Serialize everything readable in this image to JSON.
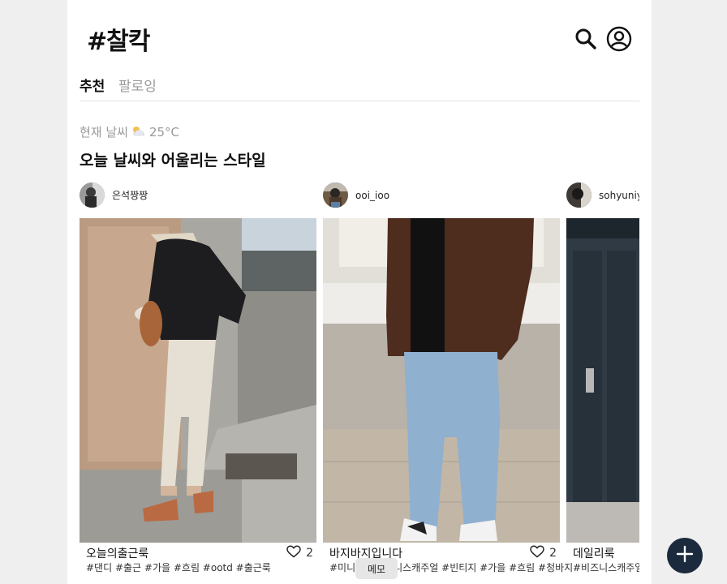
{
  "app": {
    "logo": "#찰칵"
  },
  "header": {
    "search_icon": "search-icon",
    "profile_icon": "user-circle-icon"
  },
  "tabs": [
    {
      "label": "추천",
      "active": true
    },
    {
      "label": "팔로잉",
      "active": false
    }
  ],
  "weather": {
    "label": "현재 날씨",
    "icon": "partly-cloudy-icon",
    "temperature": "25°C"
  },
  "section": {
    "title": "오늘 날씨와 어울리는 스타일"
  },
  "posts": [
    {
      "username": "은석짱짱",
      "caption": "오늘의출근룩",
      "likes": "2",
      "tags": "#댄디 #출근 #가을 #흐림 #ootd #출근룩"
    },
    {
      "username": "ooi_ioo",
      "caption": "바지바지입니다",
      "likes": "2",
      "tags": "#미니멀 #비즈니스캐주얼 #빈티지 #가을 #흐림 #청바지"
    },
    {
      "username": "sohyuniy",
      "caption": "데일리룩",
      "likes": "",
      "tags": "#비즈니스캐주얼"
    }
  ],
  "memo": {
    "label": "메모"
  },
  "fab": {
    "icon": "plus-icon"
  },
  "colors": {
    "fab_bg": "#1b2a3d",
    "muted_text": "#9a9a9a"
  }
}
